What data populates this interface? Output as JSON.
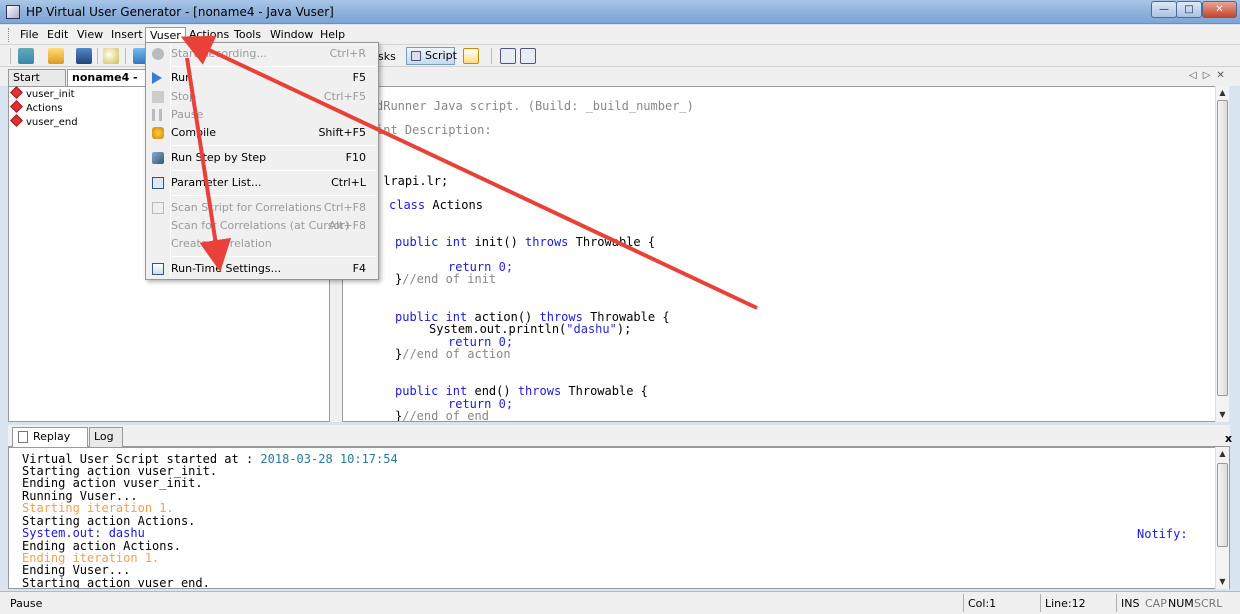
{
  "window": {
    "title": "HP Virtual User Generator - [noname4 - Java Vuser]",
    "min": "—",
    "max": "□",
    "close": "✕"
  },
  "menubar": [
    {
      "id": "file",
      "label": "File"
    },
    {
      "id": "edit",
      "label": "Edit"
    },
    {
      "id": "view",
      "label": "View"
    },
    {
      "id": "insert",
      "label": "Insert"
    },
    {
      "id": "vuser",
      "label": "Vuser"
    },
    {
      "id": "actions",
      "label": "Actions"
    },
    {
      "id": "tools",
      "label": "Tools"
    },
    {
      "id": "window",
      "label": "Window"
    },
    {
      "id": "help",
      "label": "Help"
    }
  ],
  "toolbar": {
    "tasks_label": "sks",
    "script_label": "Script"
  },
  "doc_tabs": {
    "start_page": "Start Page",
    "active": "noname4 - Jav"
  },
  "tree": {
    "items": [
      "vuser_init",
      "Actions",
      "vuser_end"
    ]
  },
  "editor": {
    "lines": [
      {
        "text": "dRunner Java script. (Build: _build_number_)",
        "cls": "cm"
      },
      {
        "text": "int Description:",
        "cls": "cm"
      },
      {
        "text": " lrapi.lr;",
        "cls": ""
      },
      {
        "text": "class Actions",
        "cls": "kwmix"
      },
      {
        "text": "public int init() throws Throwable {",
        "cls": "kwmix"
      },
      {
        "text": "return 0;",
        "cls": "kwmix"
      },
      {
        "text": "}//end of init",
        "cls": "cmmix"
      },
      {
        "text": "public int action() throws Throwable {",
        "cls": "kwmix"
      },
      {
        "text": "System.out.println(\"dashu\");",
        "cls": "strmix"
      },
      {
        "text": "return 0;",
        "cls": "kwmix"
      },
      {
        "text": "}//end of action",
        "cls": "cmmix"
      },
      {
        "text": "public int end() throws Throwable {",
        "cls": "kwmix"
      },
      {
        "text": "return 0;",
        "cls": "kwmix"
      },
      {
        "text": "}//end of end",
        "cls": "cmmix"
      }
    ]
  },
  "log_tabs": {
    "replay": "Replay Log",
    "log": "Log",
    "close": "x"
  },
  "log": {
    "lines": [
      {
        "text": "Virtual User Script started at : ",
        "time": "2018-03-28 10:17:54",
        "cls": ""
      },
      {
        "text": "Starting action vuser_init.",
        "cls": ""
      },
      {
        "text": "Ending action vuser_init.",
        "cls": ""
      },
      {
        "text": "Running Vuser...",
        "cls": ""
      },
      {
        "text": "Starting iteration 1.",
        "cls": "lt-orange"
      },
      {
        "text": "Starting action Actions.",
        "cls": ""
      },
      {
        "text": "System.out: dashu",
        "cls": "lt-blue"
      },
      {
        "text": "Ending action Actions.",
        "cls": ""
      },
      {
        "text": "Ending iteration 1.",
        "cls": "lt-orange"
      },
      {
        "text": "Ending Vuser...",
        "cls": ""
      },
      {
        "text": "Starting action vuser_end.",
        "cls": ""
      }
    ],
    "notify": "Notify:"
  },
  "vuser_menu": {
    "items": [
      {
        "label": "Start Recording...",
        "shortcut": "Ctrl+R",
        "disabled": true,
        "icon": "record-icon"
      },
      {
        "sep": true
      },
      {
        "label": "Run",
        "shortcut": "F5",
        "disabled": false,
        "icon": "run-icon"
      },
      {
        "label": "Stop",
        "shortcut": "Ctrl+F5",
        "disabled": true,
        "icon": "stop-icon"
      },
      {
        "label": "Pause",
        "shortcut": "",
        "disabled": true,
        "icon": "pause-icon"
      },
      {
        "label": "Compile",
        "shortcut": "Shift+F5",
        "disabled": false,
        "icon": "compile-icon"
      },
      {
        "sep": true
      },
      {
        "label": "Run Step by Step",
        "shortcut": "F10",
        "disabled": false,
        "icon": "step-icon"
      },
      {
        "sep": true
      },
      {
        "label": "Parameter List...",
        "shortcut": "Ctrl+L",
        "disabled": false,
        "icon": "parameter-icon"
      },
      {
        "sep": true
      },
      {
        "label": "Scan Script for Correlations",
        "shortcut": "Ctrl+F8",
        "disabled": true,
        "icon": "scan-icon"
      },
      {
        "label": "Scan for Correlations (at Cursor)",
        "shortcut": "Alt+F8",
        "disabled": true,
        "icon": ""
      },
      {
        "label": "Create Correlation",
        "shortcut": "",
        "disabled": true,
        "icon": ""
      },
      {
        "sep": true
      },
      {
        "label": "Run-Time Settings...",
        "shortcut": "F4",
        "disabled": false,
        "icon": "settings-icon"
      }
    ]
  },
  "status": {
    "mode": "Pause",
    "col": "Col:1",
    "line": "Line:12",
    "ins": "INS",
    "cap": "CAP",
    "num": "NUM",
    "scrl": "SCRL"
  },
  "colors": {
    "annotation_arrow": "#e8413a",
    "keyword": "#1a1ad8",
    "comment": "#888888",
    "orange_log": "#f0a050"
  }
}
